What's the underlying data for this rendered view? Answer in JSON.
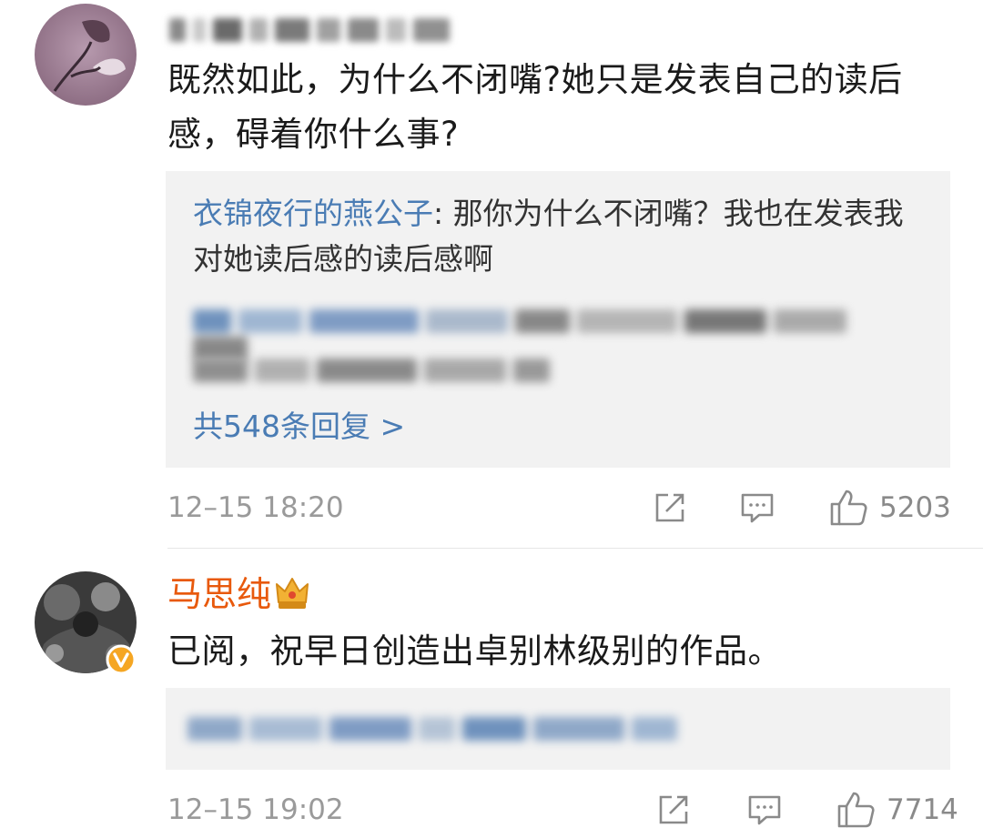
{
  "comments": [
    {
      "text": "既然如此，为什么不闭嘴?她只是发表自己的读后感，碍着你什么事?",
      "reply": {
        "author": "衣锦夜行的燕公子",
        "separator": ": ",
        "text": "那你为什么不闭嘴？我也在发表我对她读后感的读后感啊",
        "more": "共548条回复 >"
      },
      "time": "12–15 18:20",
      "likes": "5203"
    },
    {
      "author": "马思纯",
      "text": "已阅，祝早日创造出卓别林级别的作品。",
      "time": "12–15 19:02",
      "likes": "7714"
    }
  ],
  "icons": {
    "share": "share-icon",
    "comment": "comment-icon",
    "like": "thumbs-up-icon",
    "crown": "crown-badge-icon",
    "verified": "verified-badge-icon"
  },
  "colors": {
    "link": "#4a7cb4",
    "vip_name": "#e8590c",
    "meta": "#9a9a9a",
    "reply_bg": "#f2f2f2",
    "verified": "#f5a623"
  }
}
